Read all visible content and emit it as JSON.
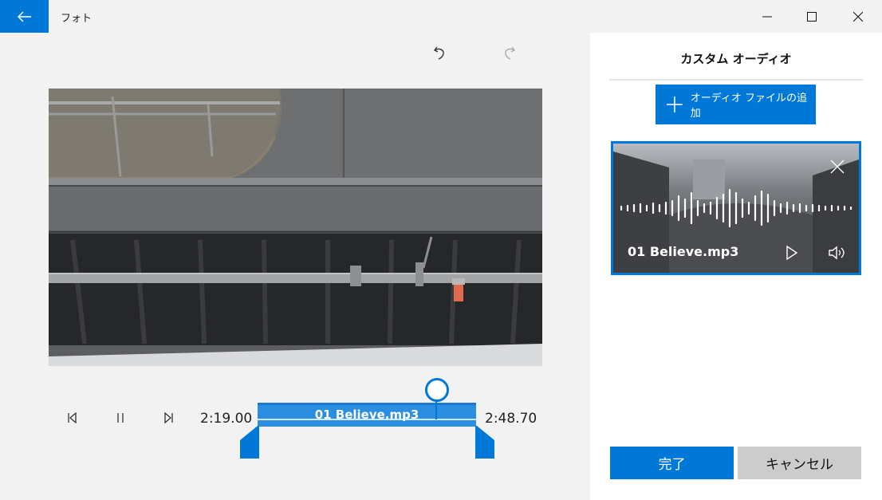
{
  "window": {
    "app_title": "フォト",
    "icons": {
      "back": "back-arrow-icon",
      "minimize": "minimize-icon",
      "maximize": "maximize-icon",
      "close": "close-icon"
    }
  },
  "editor": {
    "icons": {
      "undo": "undo-icon",
      "redo": "redo-icon"
    },
    "playback": {
      "start_time": "2:19.00",
      "end_time": "2:48.70",
      "icons": {
        "previous_frame": "step-back-icon",
        "pause": "pause-icon",
        "next_frame": "step-forward-icon"
      }
    },
    "timeline": {
      "clip_label": "01 Believe.mp3"
    }
  },
  "panel": {
    "title": "カスタム オーディオ",
    "add_audio_label": "オーディオ ファイルの追加",
    "audio_item": {
      "name": "01 Believe.mp3",
      "icons": {
        "remove": "close-icon",
        "play": "play-icon",
        "volume": "volume-icon"
      }
    },
    "done_label": "完了",
    "cancel_label": "キャンセル"
  },
  "colors": {
    "accent": "#0078d7",
    "panel_bg": "#ffffff",
    "app_bg": "#f2f2f2",
    "cancel_bg": "#cccccc"
  }
}
